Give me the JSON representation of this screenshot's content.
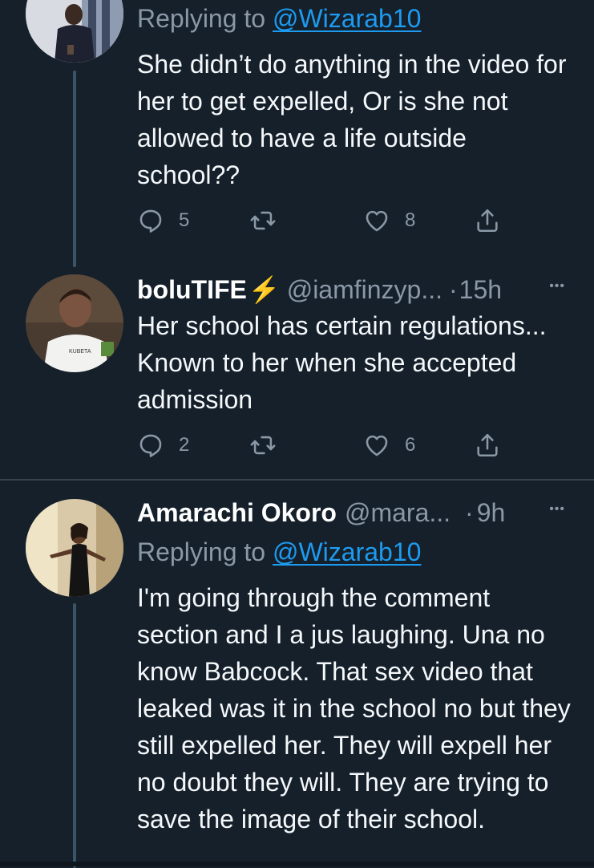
{
  "tweets": [
    {
      "name": "",
      "handle": "",
      "time": "",
      "replying_prefix": "Replying to",
      "replying_handle": "@Wizarab10",
      "text": "She didn’t do anything in the video for her to get expelled, Or is she not allowed to have a life outside school??",
      "reply_count": "5",
      "retweet_count": "",
      "like_count": "8"
    },
    {
      "name": "boluTIFE",
      "name_emoji": "⚡",
      "handle": "@iamfinzyp...",
      "dot": "·",
      "time": "15h",
      "more": "•••",
      "text": "Her school has certain regulations... Known to her when she accepted admission",
      "reply_count": "2",
      "retweet_count": "",
      "like_count": "6"
    },
    {
      "name": "Amarachi Okoro",
      "handle": "@mara...",
      "dot": "·",
      "time": "9h",
      "more": "•••",
      "replying_prefix": "Replying to",
      "replying_handle": "@Wizarab10",
      "text": "I'm going through the comment section and I a jus laughing. Una no know Babcock. That sex video that leaked was it in the school no but they still expelled her. They will expell her no doubt they will. They are trying to save the image of their school."
    }
  ],
  "icons": {
    "reply": "reply-icon",
    "retweet": "retweet-icon",
    "like": "heart-icon",
    "share": "share-icon"
  },
  "colors": {
    "background": "#15202b",
    "link": "#1d9bf0",
    "secondary_text": "#8b98a5",
    "thread_line": "#3d5466",
    "divider": "#38444d"
  }
}
